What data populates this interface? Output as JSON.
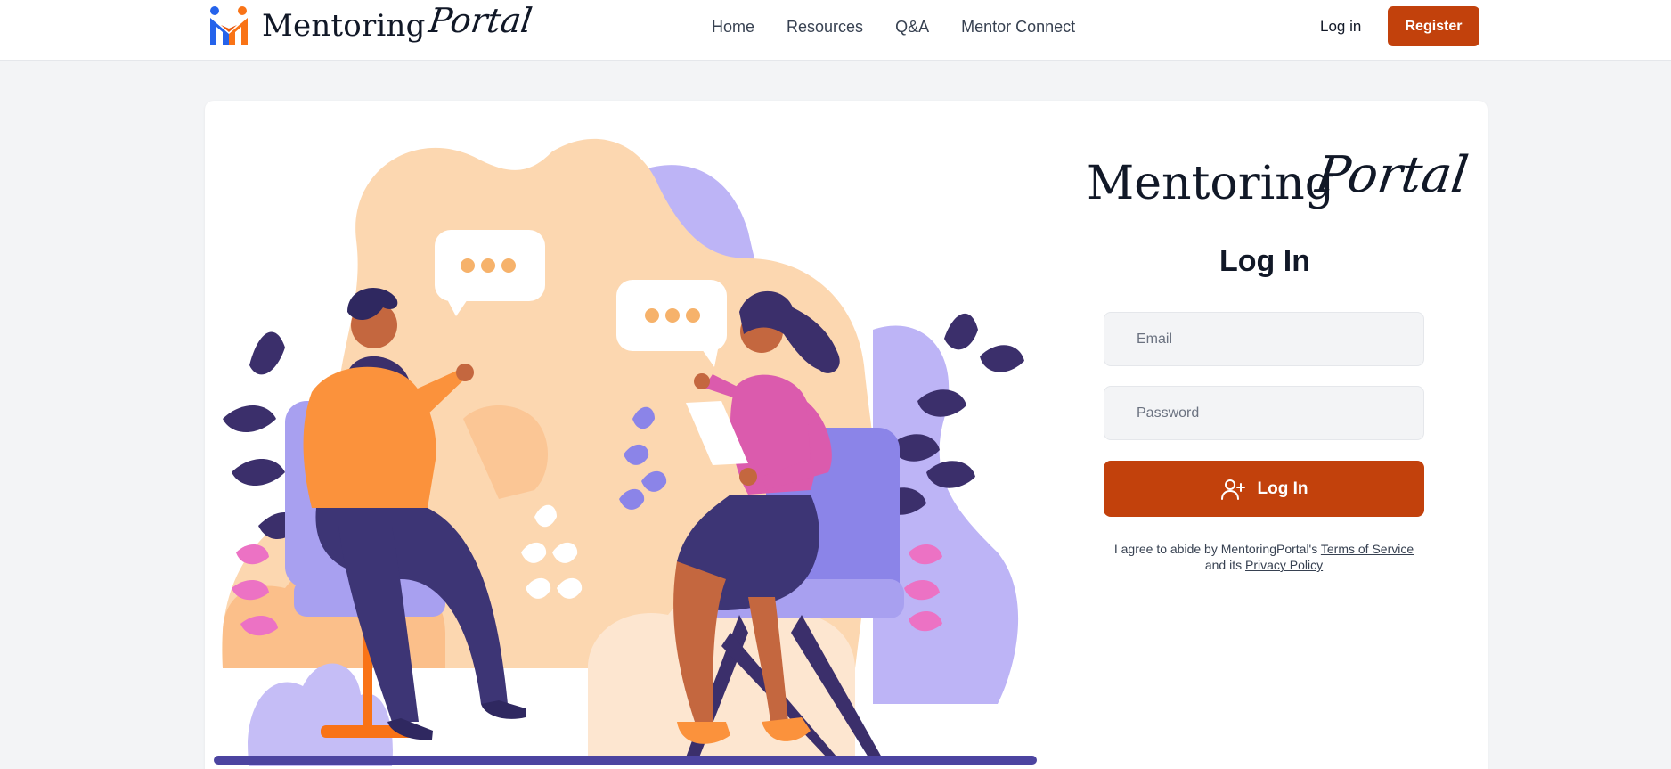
{
  "brand": {
    "word": "Mentoring",
    "script": "Portal"
  },
  "nav": {
    "home": "Home",
    "resources": "Resources",
    "qa": "Q&A",
    "mentor_connect": "Mentor Connect"
  },
  "auth": {
    "login": "Log in",
    "register": "Register"
  },
  "form": {
    "brand_word": "Mentoring",
    "brand_script": "Portal",
    "title": "Log In",
    "email_placeholder": "Email",
    "password_placeholder": "Password",
    "submit_label": "Log In",
    "terms_prefix": "I agree to abide by MentoringPortal's",
    "terms_link": "Terms of Service",
    "terms_middle": "and its",
    "privacy_link": "Privacy Policy"
  },
  "colors": {
    "accent": "#c2410c",
    "page_bg": "#f3f4f6",
    "card_bg": "#ffffff"
  },
  "icons": {
    "submit_icon": "user-plus-icon",
    "logo_icon": "brand-logo-icon"
  }
}
